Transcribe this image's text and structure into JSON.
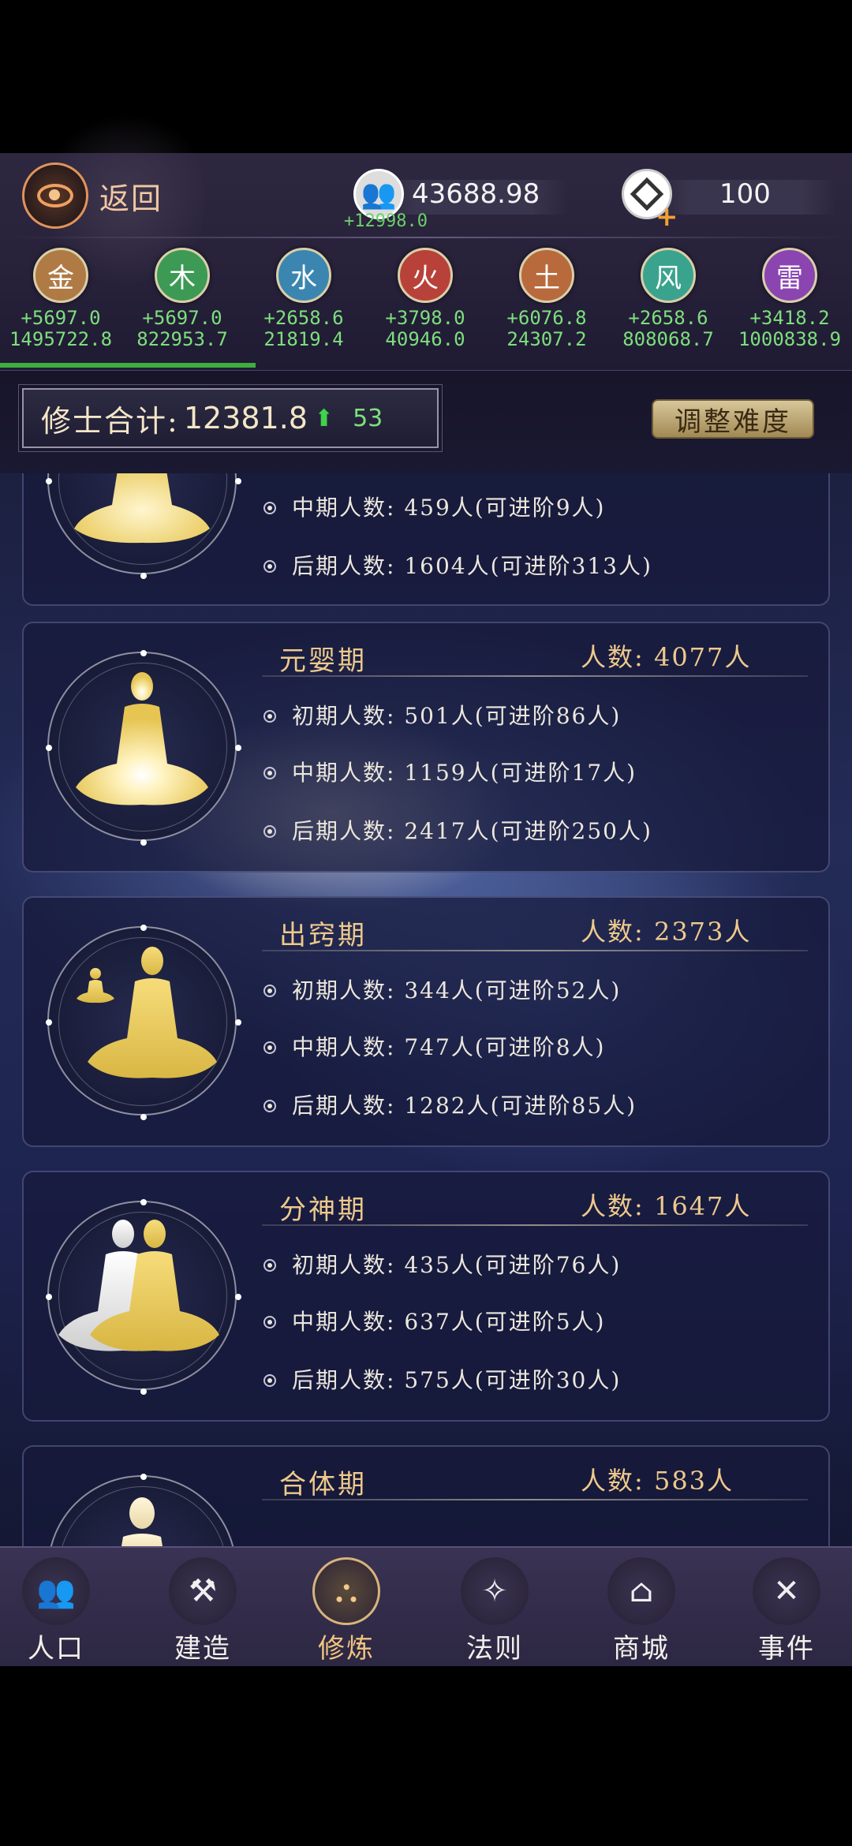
{
  "header": {
    "back_label": "返回",
    "population_value": "43688.98",
    "population_delta": "+12998.0",
    "gem_value": "100"
  },
  "elements": [
    {
      "name": "金",
      "delta": "+5697.0",
      "total": "1495722.8",
      "color": "#b07a45"
    },
    {
      "name": "木",
      "delta": "+5697.0",
      "total": "822953.7",
      "color": "#3c9a55"
    },
    {
      "name": "水",
      "delta": "+2658.6",
      "total": "21819.4",
      "color": "#3b86b0"
    },
    {
      "name": "火",
      "delta": "+3798.0",
      "total": "40946.0",
      "color": "#b8423a"
    },
    {
      "name": "土",
      "delta": "+6076.8",
      "total": "24307.2",
      "color": "#b86a3c"
    },
    {
      "name": "风",
      "delta": "+2658.6",
      "total": "808068.7",
      "color": "#3aa38e"
    },
    {
      "name": "雷",
      "delta": "+3418.2",
      "total": "1000838.9",
      "color": "#8a45b0"
    }
  ],
  "summary": {
    "label": "修士合计:",
    "value": "12381.8",
    "rank": "53",
    "adjust_label": "调整难度"
  },
  "realms": [
    {
      "name": "",
      "count": "",
      "stages": [
        "",
        "中期人数: 459人(可进阶9人)",
        "后期人数: 1604人(可进阶313人)"
      ]
    },
    {
      "name": "元婴期",
      "count": "人数: 4077人",
      "stages": [
        "初期人数: 501人(可进阶86人)",
        "中期人数: 1159人(可进阶17人)",
        "后期人数: 2417人(可进阶250人)"
      ]
    },
    {
      "name": "出窍期",
      "count": "人数: 2373人",
      "stages": [
        "初期人数: 344人(可进阶52人)",
        "中期人数: 747人(可进阶8人)",
        "后期人数: 1282人(可进阶85人)"
      ]
    },
    {
      "name": "分神期",
      "count": "人数: 1647人",
      "stages": [
        "初期人数: 435人(可进阶76人)",
        "中期人数: 637人(可进阶5人)",
        "后期人数: 575人(可进阶30人)"
      ]
    },
    {
      "name": "合体期",
      "count": "人数: 583人",
      "stages": []
    }
  ],
  "nav": [
    {
      "label": "人口",
      "icon": "people-icon"
    },
    {
      "label": "建造",
      "icon": "build-tools-icon"
    },
    {
      "label": "修炼",
      "icon": "meditation-icon"
    },
    {
      "label": "法则",
      "icon": "law-banner-icon"
    },
    {
      "label": "商城",
      "icon": "shop-icon"
    },
    {
      "label": "事件",
      "icon": "event-book-icon"
    }
  ],
  "colors": {
    "accent_gold": "#eec98c",
    "increase_green": "#7ddf7d"
  }
}
